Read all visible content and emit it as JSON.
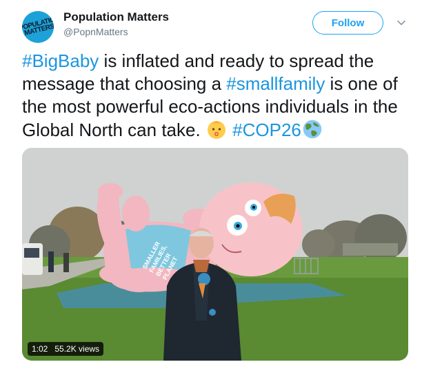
{
  "account": {
    "name": "Population Matters",
    "handle": "@PopnMatters",
    "avatar_text": "POPULATION MATTERS"
  },
  "follow_label": "Follow",
  "tweet": {
    "hashtag_bigbaby": "#BigBaby",
    "text_1": " is inflated and ready to spread the message that choosing a ",
    "hashtag_smallfamily": "#smallfamily",
    "text_2": " is one of the most powerful eco-actions individuals in the Global North can take. ",
    "hashtag_cop26": "#COP26",
    "emoji_1": "baby-face-emoji",
    "emoji_2": "earth-globe-emoji"
  },
  "video": {
    "duration": "1:02",
    "views": "55.2K views",
    "banner_text": [
      "SMALLER",
      "FAMILIES,",
      "BETTER",
      "PLANET"
    ]
  },
  "colors": {
    "link": "#1b95e0",
    "follow": "#1da1f2",
    "brand": "#1da1d8"
  }
}
